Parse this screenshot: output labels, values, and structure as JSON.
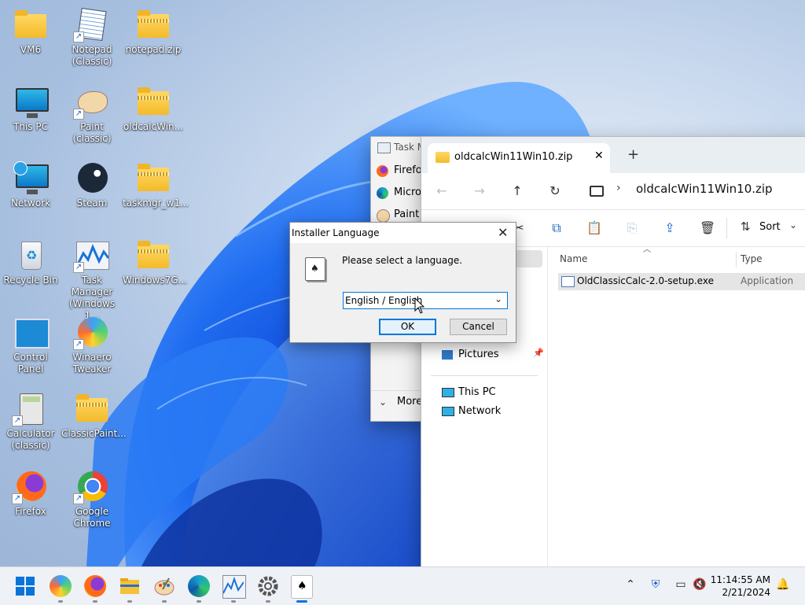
{
  "desktop": {
    "icons": [
      {
        "label": "VM6"
      },
      {
        "label": "Notepad (Classic)"
      },
      {
        "label": "notepad.zip"
      },
      {
        "label": "This PC"
      },
      {
        "label": "Paint (classic)"
      },
      {
        "label": "oldcalcWin..."
      },
      {
        "label": "Network"
      },
      {
        "label": "Steam"
      },
      {
        "label": "taskmgr_w1..."
      },
      {
        "label": "Recycle Bin"
      },
      {
        "label": "Task Manager (Windows 1..."
      },
      {
        "label": "Windows7G..."
      },
      {
        "label": "Control Panel"
      },
      {
        "label": "Winaero Tweaker"
      },
      {
        "label": "Calculator (classic)"
      },
      {
        "label": "ClassicPaint..."
      },
      {
        "label": "Firefox"
      },
      {
        "label": "Google Chrome"
      }
    ]
  },
  "task_manager": {
    "title": "Task M",
    "rows": [
      "Firefox",
      "Micros",
      "Paint ("
    ],
    "more": "More"
  },
  "explorer": {
    "tab_title": "oldcalcWin11Win10.zip",
    "tab_close": "✕",
    "new_tab": "+",
    "address": "oldcalcWin11Win10.zip",
    "sort_label": "Sort",
    "columns": {
      "name": "Name",
      "type": "Type"
    },
    "files": [
      {
        "name": "OldClassicCalc-2.0-setup.exe",
        "type": "Application"
      }
    ],
    "sidebar": [
      {
        "label": "Pictures",
        "pinned": true
      },
      {
        "label": "This PC",
        "pinned": false
      },
      {
        "label": "Network",
        "pinned": false
      }
    ]
  },
  "installer": {
    "title": "Installer Language",
    "prompt": "Please select a language.",
    "selected_language": "English / English",
    "ok_label": "OK",
    "cancel_label": "Cancel"
  },
  "taskbar": {
    "time": "11:14:55 AM",
    "date": "2/21/2024",
    "pinned_icons": [
      "start-icon",
      "winaero-icon",
      "firefox-icon",
      "file-explorer-icon",
      "paint-icon",
      "edge-icon",
      "task-manager-icon",
      "settings-icon",
      "installer-icon"
    ]
  }
}
